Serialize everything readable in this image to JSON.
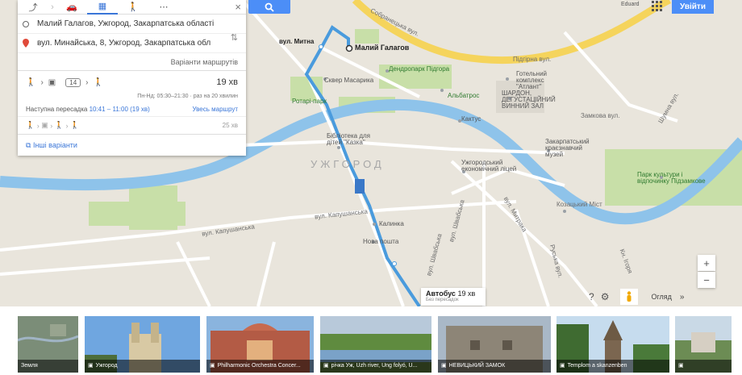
{
  "modes": {
    "items": [
      {
        "icon": "directions-icon",
        "glyph": "⤴",
        "active": false
      },
      {
        "icon": "car-icon",
        "glyph": "🚗",
        "active": false
      },
      {
        "icon": "bus-icon",
        "glyph": "▦",
        "active": true
      },
      {
        "icon": "walk-icon",
        "glyph": "🚶",
        "active": false
      },
      {
        "icon": "more-icon",
        "glyph": "⋯",
        "active": false
      }
    ],
    "close": "×"
  },
  "route_inputs": {
    "origin": "Малий Галагов, Ужгород, Закарпатська області",
    "destination": "вул. Минайська, 8, Ужгород, Закарпатська обл",
    "variants_label": "Варіанти маршрутів"
  },
  "route_main": {
    "bus_number": "14",
    "duration": "19 хв",
    "schedule": "Пн-Нд: 05:30–21:30 · раз на 20 хвилин",
    "next_label": "Наступна пересадка",
    "next_time": "10:41 – 11:00 (19 хв)",
    "full_route": "Увесь маршрут"
  },
  "route_alt": {
    "duration": "25 хв"
  },
  "other_options": "Інші варіанти",
  "topbar": {
    "enter": "Увійти",
    "user": "Eduard"
  },
  "controls": {
    "zoom_in": "+",
    "zoom_out": "−",
    "review": "Огляд",
    "help": "?",
    "settings": "⚙",
    "chevron": "»"
  },
  "bus_info": {
    "title": "Автобус",
    "duration": "19 хв",
    "sub": "Без пересадок"
  },
  "map_labels": {
    "malyi_halahov": "Малий Галагов",
    "mytna": "вул. Митна",
    "sobranetska": "Собранецька вул.",
    "pidhirna": "Підгірна вул.",
    "hotel_atlant": "Готельний комплекс \"Атлант\"",
    "shardon": "ШАРДОН, ДЕГУСТАЦІЙНИЙ ВИННИЙ ЗАЛ",
    "kaktus": "Кактус",
    "albatros": "Альбатрос",
    "dendropark": "Дендропарк Підгора",
    "uzh": "УЖГОРОД",
    "library": "Бібліотека для дітей \"Казка\"",
    "skver": "Сквер Масарика",
    "rotari": "Ротарі-парк",
    "kapushanska": "вул. Капушанська",
    "kapushanska2": "вул. Капушанська",
    "kalyna": "Калинка",
    "vil": "Нова пошта",
    "uzhgorod_nat": "Ужгородський економічний ліцей",
    "krai_muzei": "Закарпатський краєзнавчий музей",
    "park": "Парк культури і відпочинку Підзамкове",
    "mytropolit": "вул. Митрака",
    "shumna": "Шумна вул.",
    "russka": "Руська вул.",
    "veresh": "вул. Швабська",
    "vyhod": "вул. Швабська",
    "zamkova": "Замкова вул.",
    "knyazhna": "Кн. Ігоря",
    "krasnyi": "Козацький Міст"
  },
  "photos": [
    {
      "label": "Земля",
      "icon": "globe-icon"
    },
    {
      "label": "Ужгород",
      "icon": "camera-icon"
    },
    {
      "label": "Philharmonic Orchestra Concer...",
      "icon": "camera-icon"
    },
    {
      "label": "річка Уж, Uzh river, Ung folyó, U...",
      "icon": "camera-icon"
    },
    {
      "label": "НЕВИЦЬКИЙ ЗАМОК",
      "icon": "camera-icon"
    },
    {
      "label": "Templom a skanzenben",
      "icon": "camera-icon"
    },
    {
      "label": "",
      "icon": "camera-icon"
    }
  ]
}
